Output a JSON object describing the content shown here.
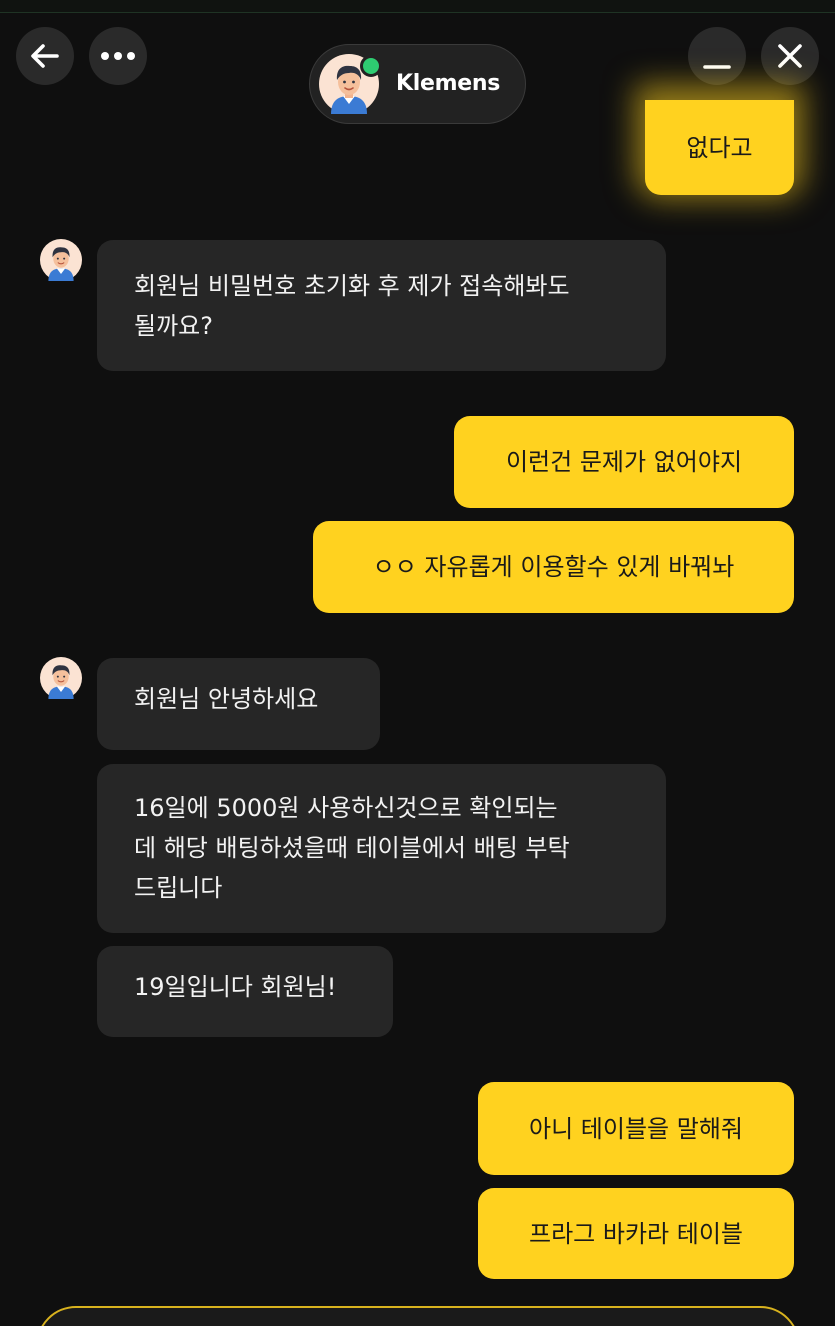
{
  "header": {
    "agent_name": "Klemens",
    "online_status_color": "#2ecc71",
    "buttons": {
      "back": "back-arrow-icon",
      "more": "ellipsis-icon",
      "minimize": "minimize-icon",
      "close": "close-icon"
    }
  },
  "theme": {
    "user_bubble_color": "#ffd21f",
    "agent_bubble_color": "#262626",
    "background_color": "#0f0f0f"
  },
  "messages": [
    {
      "sender": "user",
      "text": "없다고"
    },
    {
      "sender": "agent",
      "text": "회원님 비밀번호 초기화 후 제가 접속해봐도\n될까요?"
    },
    {
      "sender": "user",
      "text": "이런건 문제가 없어야지"
    },
    {
      "sender": "user",
      "text": "ㅇㅇ 자유롭게 이용할수 있게 바꿔놔"
    },
    {
      "sender": "agent",
      "text": "회원님 안녕하세요"
    },
    {
      "sender": "agent",
      "text": "16일에 5000원 사용하신것으로 확인되는\n데 해당 배팅하셨을때 테이블에서 배팅 부탁\n드립니다"
    },
    {
      "sender": "agent",
      "text": "19일입니다 회원님!"
    },
    {
      "sender": "user",
      "text": "아니 테이블을 말해줘"
    },
    {
      "sender": "user",
      "text": "프라그 바카라 테이블"
    }
  ],
  "composer": {
    "placeholder": ""
  }
}
